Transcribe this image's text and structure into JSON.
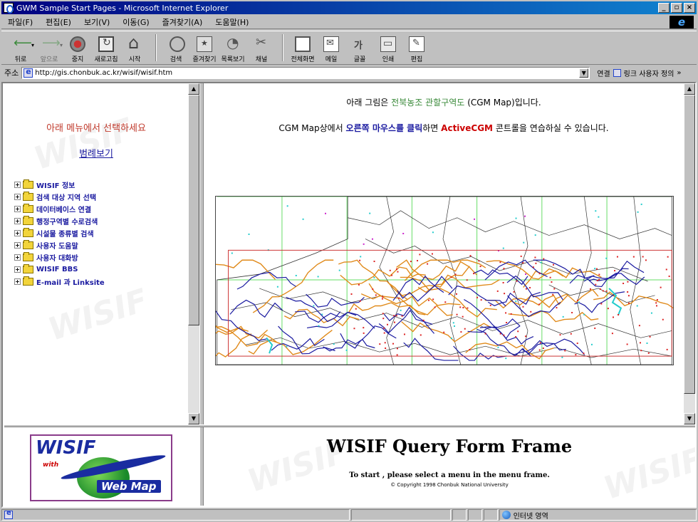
{
  "window": {
    "title": "GWM Sample Start Pages - Microsoft Internet Explorer",
    "controls": [
      "_",
      "▫",
      "×"
    ]
  },
  "menubar": {
    "items": [
      "파일(F)",
      "편집(E)",
      "보기(V)",
      "이동(G)",
      "즐겨찾기(A)",
      "도움말(H)"
    ]
  },
  "toolbar": {
    "back": "뒤로",
    "forward": "앞으로",
    "stop": "중지",
    "refresh": "새로고침",
    "home": "시작",
    "search": "검색",
    "favorites": "즐겨찾기",
    "history": "목록보기",
    "channels": "채널",
    "fullscreen": "전체화면",
    "mail": "메일",
    "font": "글꼴",
    "print": "인쇄",
    "edit": "편집"
  },
  "address": {
    "label": "주소",
    "url": "http://gis.chonbuk.ac.kr/wisif/wisif.htm",
    "go": "연결",
    "links": "링크 사용자 정의"
  },
  "left_menu": {
    "title": "아래 메뉴에서 선택하세요",
    "legend_link": "범례보기",
    "items": [
      "WISIF 정보",
      "검색 대상 지역 선택",
      "데이터베이스 연결",
      "행정구역별 수로검색",
      "시설물 종류별 검색",
      "사용자 도움말",
      "사용자 대화방",
      "WISIF BBS",
      "E-mail 과 Linksite"
    ]
  },
  "main": {
    "intro_prefix": "아래 그림은",
    "intro_highlight": "전북농조 관할구역도",
    "intro_suffix": "(CGM Map)입니다.",
    "hint_prefix": "CGM Map상에서",
    "hint_blue": "오른쪽 마우스를 클릭",
    "hint_mid": "하면",
    "hint_red": "ActiveCGM",
    "hint_suffix": "콘트롤을 연습하실 수 있습니다."
  },
  "logo": {
    "wisif": "WISIF",
    "with": "with",
    "webmap": "Web Map"
  },
  "query_frame": {
    "title": "WISIF Query Form Frame",
    "subtitle": "To start , please select a menu in the menu frame.",
    "copyright": "© Copyright 1998 Chonbuk National University"
  },
  "status": {
    "zone": "인터넷 영역"
  },
  "colors": {
    "title_bar": "#000080",
    "menu_title": "#c0392b",
    "link": "#1a1aa0",
    "map_grid": "#66dd66",
    "map_frame": "#cc3333",
    "map_river_blue": "#1a1aa0",
    "map_canal_orange": "#e08a1a",
    "map_dot_red": "#dd2222",
    "map_dot_cyan": "#22cccc",
    "map_dot_magenta": "#cc22cc"
  }
}
